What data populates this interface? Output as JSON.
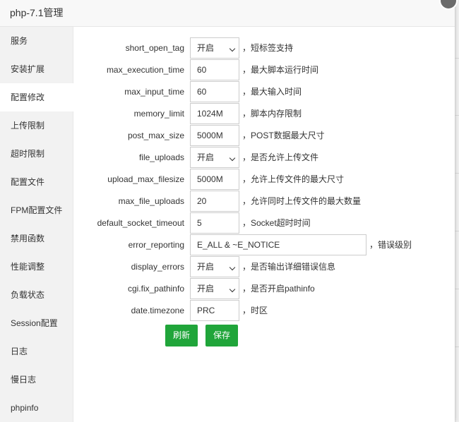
{
  "title": "php-7.1管理",
  "sidebar": {
    "items": [
      {
        "label": "服务"
      },
      {
        "label": "安装扩展"
      },
      {
        "label": "配置修改"
      },
      {
        "label": "上传限制"
      },
      {
        "label": "超时限制"
      },
      {
        "label": "配置文件"
      },
      {
        "label": "FPM配置文件"
      },
      {
        "label": "禁用函数"
      },
      {
        "label": "性能调整"
      },
      {
        "label": "负载状态"
      },
      {
        "label": "Session配置"
      },
      {
        "label": "日志"
      },
      {
        "label": "慢日志"
      },
      {
        "label": "phpinfo"
      }
    ],
    "active_index": 2
  },
  "form": {
    "rows": [
      {
        "label": "short_open_tag",
        "type": "select",
        "value": "开启",
        "desc": "，短标签支持"
      },
      {
        "label": "max_execution_time",
        "type": "input",
        "value": "60",
        "desc": "，最大脚本运行时间"
      },
      {
        "label": "max_input_time",
        "type": "input",
        "value": "60",
        "desc": "，最大输入时间"
      },
      {
        "label": "memory_limit",
        "type": "input",
        "value": "1024M",
        "desc": "，脚本内存限制"
      },
      {
        "label": "post_max_size",
        "type": "input",
        "value": "5000M",
        "desc": "，POST数据最大尺寸"
      },
      {
        "label": "file_uploads",
        "type": "select",
        "value": "开启",
        "desc": "，是否允许上传文件"
      },
      {
        "label": "upload_max_filesize",
        "type": "input",
        "value": "5000M",
        "desc": "，允许上传文件的最大尺寸"
      },
      {
        "label": "max_file_uploads",
        "type": "input",
        "value": "20",
        "desc": "，允许同时上传文件的最大数量"
      },
      {
        "label": "default_socket_timeout",
        "type": "input",
        "value": "5",
        "desc": "，Socket超时时间"
      },
      {
        "label": "error_reporting",
        "type": "input-wide",
        "value": "E_ALL & ~E_NOTICE",
        "desc": "，错误级别"
      },
      {
        "label": "display_errors",
        "type": "select",
        "value": "开启",
        "desc": "，是否输出详细错误信息"
      },
      {
        "label": "cgi.fix_pathinfo",
        "type": "select",
        "value": "开启",
        "desc": "，是否开启pathinfo"
      },
      {
        "label": "date.timezone",
        "type": "input",
        "value": "PRC",
        "desc": "，时区"
      }
    ]
  },
  "buttons": {
    "refresh_label": "刷新",
    "save_label": "保存"
  },
  "colors": {
    "accent": "#20a53a",
    "sidebar_bg": "#f2f2f2",
    "close_button": "#6b6b6b"
  }
}
